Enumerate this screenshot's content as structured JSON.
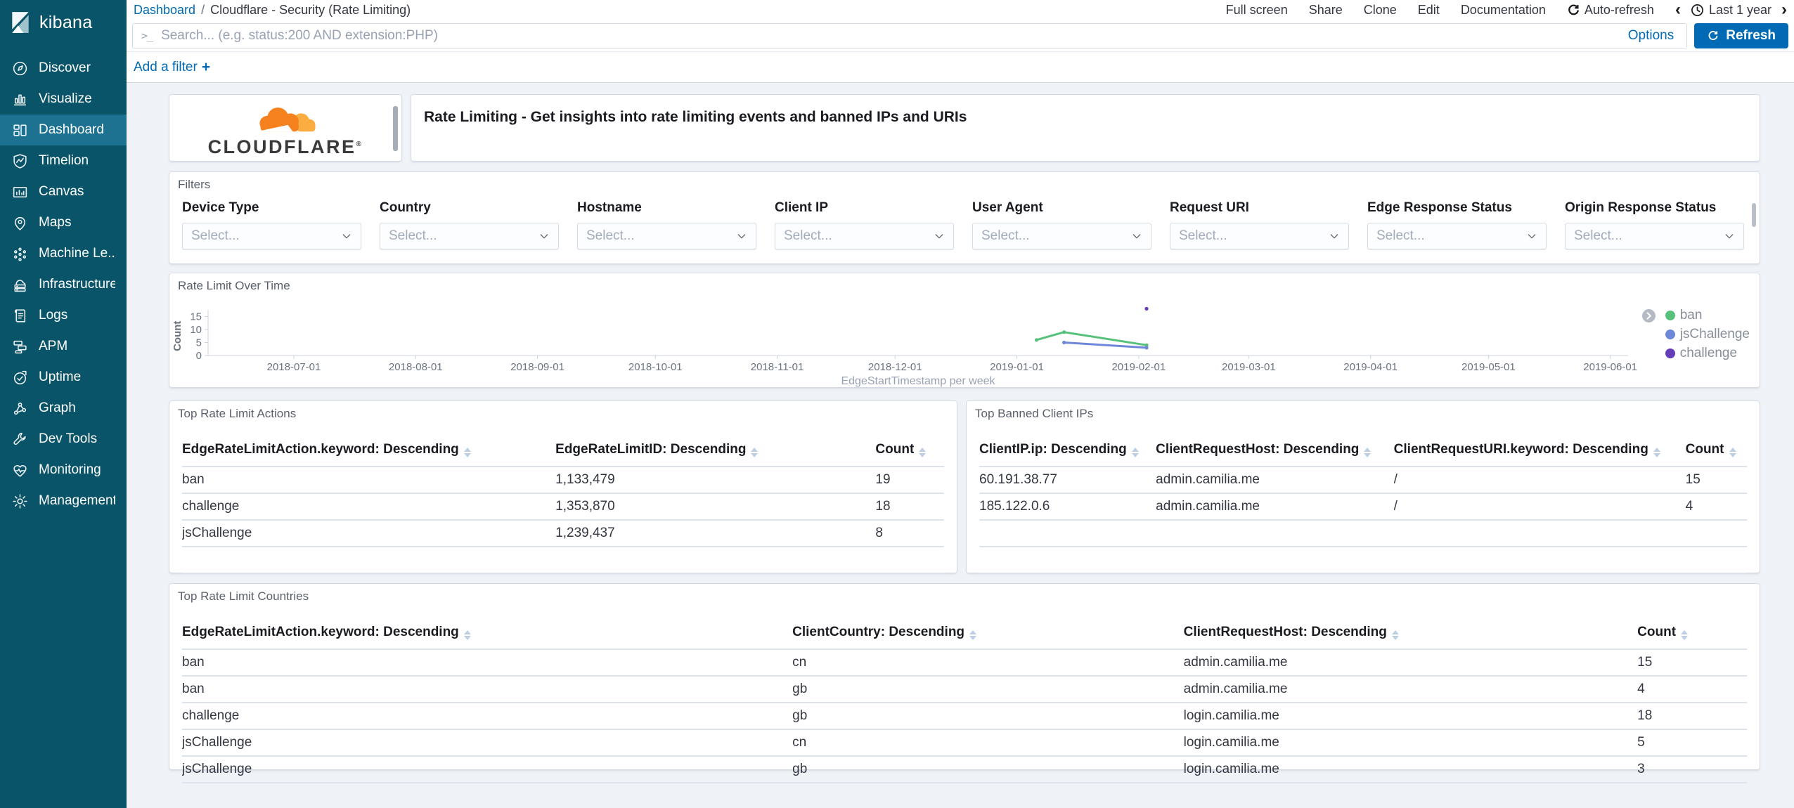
{
  "colors": {
    "accent": "#006bb4",
    "sidebar_bg": "#0a5469",
    "sidebar_active_bg": "#1d7292",
    "cloudflare_orange": "#f6821f",
    "cloudflare_light_orange": "#fbad41",
    "series_ban": "#57c17b",
    "series_jschallenge": "#6f87d8",
    "series_challenge": "#663db8"
  },
  "sidebar": {
    "logo_text": "kibana",
    "items": [
      {
        "label": "Discover",
        "icon": "compass-icon",
        "active": false
      },
      {
        "label": "Visualize",
        "icon": "bar-chart-icon",
        "active": false
      },
      {
        "label": "Dashboard",
        "icon": "dashboard-grid-icon",
        "active": true
      },
      {
        "label": "Timelion",
        "icon": "timelion-shield-icon",
        "active": false
      },
      {
        "label": "Canvas",
        "icon": "canvas-frame-icon",
        "active": false
      },
      {
        "label": "Maps",
        "icon": "map-pin-icon",
        "active": false
      },
      {
        "label": "Machine Le...",
        "icon": "machine-learning-dots-icon",
        "active": false
      },
      {
        "label": "Infrastructure",
        "icon": "cloud-server-icon",
        "active": false
      },
      {
        "label": "Logs",
        "icon": "document-lines-icon",
        "active": false
      },
      {
        "label": "APM",
        "icon": "layers-icon",
        "active": false
      },
      {
        "label": "Uptime",
        "icon": "clock-check-icon",
        "active": false
      },
      {
        "label": "Graph",
        "icon": "network-nodes-icon",
        "active": false
      },
      {
        "label": "Dev Tools",
        "icon": "wrench-icon",
        "active": false
      },
      {
        "label": "Monitoring",
        "icon": "heart-pulse-icon",
        "active": false
      },
      {
        "label": "Management",
        "icon": "gear-icon",
        "active": false
      }
    ]
  },
  "topbar": {
    "breadcrumb": {
      "root": "Dashboard",
      "separator": "/",
      "current": "Cloudflare - Security (Rate Limiting)"
    },
    "actions": [
      "Full screen",
      "Share",
      "Clone",
      "Edit",
      "Documentation"
    ],
    "auto_refresh_label": "Auto-refresh",
    "time_prev_icon": "‹",
    "time_next_icon": "›",
    "time_range_label": "Last 1 year"
  },
  "query_bar": {
    "prompt_icon": ">_",
    "placeholder": "Search... (e.g. status:200 AND extension:PHP)",
    "options_label": "Options",
    "refresh_label": "Refresh"
  },
  "filter_bar": {
    "add_filter_label": "Add a filter",
    "plus_icon": "+"
  },
  "branding_panel": {
    "brand_text": "CLOUDFLARE",
    "registered_mark": "®"
  },
  "header_panel": {
    "title": "Rate Limiting - Get insights into rate limiting events and banned IPs and URIs"
  },
  "filters_panel": {
    "title": "Filters",
    "select_placeholder": "Select...",
    "fields": [
      "Device Type",
      "Country",
      "Hostname",
      "Client IP",
      "User Agent",
      "Request URI",
      "Edge Response Status",
      "Origin Response Status"
    ]
  },
  "chart_panel": {
    "title": "Rate Limit Over Time"
  },
  "chart_data": {
    "type": "line",
    "title": "Rate Limit Over Time",
    "xlabel": "EdgeStartTimestamp per week",
    "ylabel": "Count",
    "y_ticks": [
      0,
      5,
      10,
      15
    ],
    "ylim": [
      0,
      20
    ],
    "x_ticks": [
      "2018-07-01",
      "2018-08-01",
      "2018-09-01",
      "2018-10-01",
      "2018-11-01",
      "2018-12-01",
      "2019-01-01",
      "2019-02-01",
      "2019-03-01",
      "2019-04-01",
      "2019-05-01",
      "2019-06-01"
    ],
    "legend_position": "right",
    "series": [
      {
        "name": "ban",
        "color": "#57c17b",
        "points": [
          [
            "2019-01-06",
            6
          ],
          [
            "2019-01-13",
            9
          ],
          [
            "2019-02-03",
            4
          ]
        ]
      },
      {
        "name": "jsChallenge",
        "color": "#6f87d8",
        "points": [
          [
            "2019-01-13",
            5
          ],
          [
            "2019-02-03",
            3
          ]
        ]
      },
      {
        "name": "challenge",
        "color": "#663db8",
        "points": [
          [
            "2019-02-03",
            18
          ]
        ]
      }
    ]
  },
  "tables": [
    {
      "id": "actions",
      "title": "Top Rate Limit Actions",
      "columns": [
        "EdgeRateLimitAction.keyword: Descending",
        "EdgeRateLimitID: Descending",
        "Count"
      ],
      "widths": [
        49,
        42,
        9
      ],
      "rows": [
        [
          "ban",
          "1,133,479",
          "19"
        ],
        [
          "challenge",
          "1,353,870",
          "18"
        ],
        [
          "jsChallenge",
          "1,239,437",
          "8"
        ]
      ],
      "empty_rows": 1
    },
    {
      "id": "banned",
      "title": "Top Banned Client IPs",
      "columns": [
        "ClientIP.ip: Descending",
        "ClientRequestHost: Descending",
        "ClientRequestURI.keyword: Descending",
        "Count"
      ],
      "widths": [
        23,
        31,
        38,
        8
      ],
      "rows": [
        [
          "60.191.38.77",
          "admin.camilia.me",
          "/",
          "15"
        ],
        [
          "185.122.0.6",
          "admin.camilia.me",
          "/",
          "4"
        ]
      ],
      "empty_rows": 2
    },
    {
      "id": "countries",
      "title": "Top Rate Limit Countries",
      "columns": [
        "EdgeRateLimitAction.keyword: Descending",
        "ClientCountry: Descending",
        "ClientRequestHost: Descending",
        "Count"
      ],
      "widths": [
        39,
        25,
        29,
        7
      ],
      "rows": [
        [
          "ban",
          "cn",
          "admin.camilia.me",
          "15"
        ],
        [
          "ban",
          "gb",
          "admin.camilia.me",
          "4"
        ],
        [
          "challenge",
          "gb",
          "login.camilia.me",
          "18"
        ],
        [
          "jsChallenge",
          "cn",
          "login.camilia.me",
          "5"
        ],
        [
          "jsChallenge",
          "gb",
          "login.camilia.me",
          "3"
        ]
      ],
      "empty_rows": 0
    }
  ]
}
